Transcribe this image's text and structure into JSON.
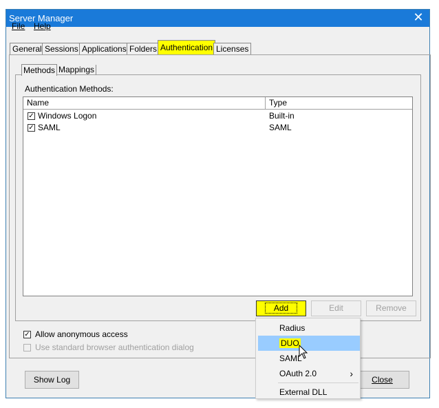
{
  "window": {
    "title": "Server Manager",
    "close_glyph": "✕"
  },
  "menubar": {
    "file": "File",
    "help": "Help"
  },
  "tabs": [
    {
      "label": "General"
    },
    {
      "label": "Sessions"
    },
    {
      "label": "Applications"
    },
    {
      "label": "Folders"
    },
    {
      "label": "Authentication",
      "active": true
    },
    {
      "label": "Licenses"
    }
  ],
  "subtabs": [
    {
      "label": "Methods",
      "active": true
    },
    {
      "label": "Mappings"
    }
  ],
  "auth": {
    "group_label": "Authentication Methods:",
    "columns": [
      "Name",
      "Type"
    ],
    "rows": [
      {
        "name": "Windows Logon",
        "type": "Built-in",
        "checked": true
      },
      {
        "name": "SAML",
        "type": "SAML",
        "checked": true
      }
    ],
    "buttons": {
      "add": "Add",
      "edit": "Edit",
      "remove": "Remove"
    }
  },
  "options": {
    "allow_anonymous": "Allow anonymous access",
    "allow_anonymous_checked": true,
    "standard_dialog": "Use standard browser authentication dialog",
    "standard_dialog_checked": false
  },
  "footer": {
    "show_log": "Show Log",
    "close": "Close"
  },
  "add_menu": {
    "items": [
      {
        "label": "Radius"
      },
      {
        "label": "DUO",
        "selected": true
      },
      {
        "label": "SAML"
      },
      {
        "label": "OAuth 2.0",
        "submenu": true
      },
      {
        "label": "External DLL"
      }
    ],
    "submenu_glyph": "›"
  },
  "colors": {
    "highlight": "#ffff00",
    "titlebar": "#1a7ad9",
    "menu_selection": "#99ccff"
  }
}
